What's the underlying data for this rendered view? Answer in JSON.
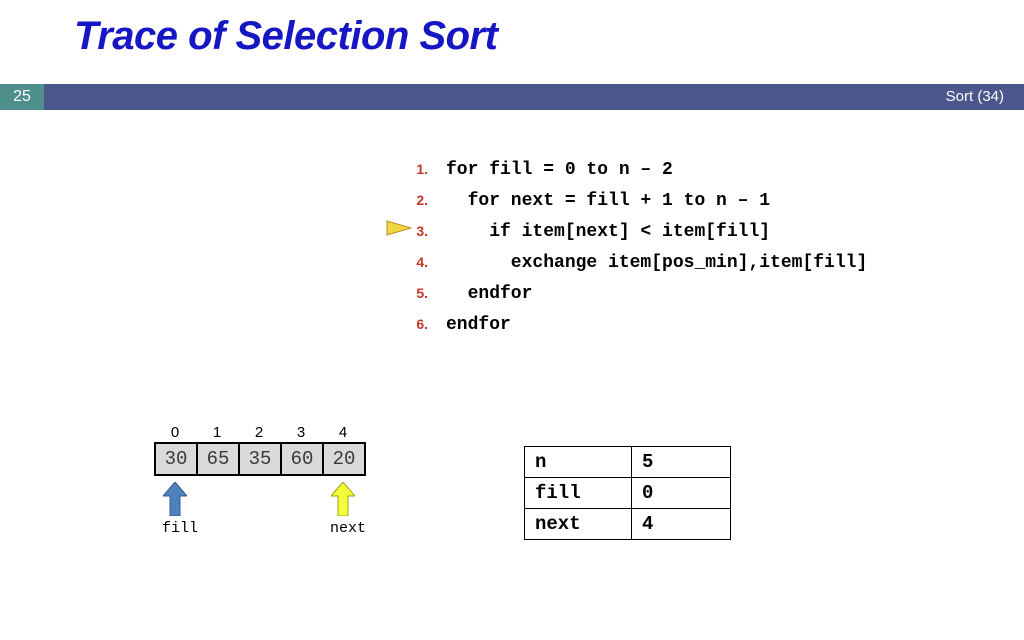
{
  "title": "Trace of Selection Sort",
  "page_number": "25",
  "banner_right": "Sort (34)",
  "code": {
    "l1": {
      "n": "1.",
      "t": "for fill = 0 to n – 2"
    },
    "l2": {
      "n": "2.",
      "t": "  for next = fill + 1 to n – 1"
    },
    "l3": {
      "n": "3.",
      "t": "    if item[next] < item[fill]"
    },
    "l4": {
      "n": "4.",
      "t": "      exchange item[pos_min],item[fill]"
    },
    "l5": {
      "n": "5.",
      "t": "  endfor"
    },
    "l6": {
      "n": "6.",
      "t": "endfor"
    }
  },
  "array": {
    "indices": [
      "0",
      "1",
      "2",
      "3",
      "4"
    ],
    "values": [
      "30",
      "65",
      "35",
      "60",
      "20"
    ]
  },
  "arrows": {
    "fill_label": "fill",
    "next_label": "next"
  },
  "vars": {
    "r1": {
      "k": "n",
      "v": "5"
    },
    "r2": {
      "k": "fill",
      "v": "0"
    },
    "r3": {
      "k": "next",
      "v": "4"
    }
  },
  "chart_data": {
    "type": "table",
    "array_indices": [
      0,
      1,
      2,
      3,
      4
    ],
    "array_values": [
      30,
      65,
      35,
      60,
      20
    ],
    "variables": {
      "n": 5,
      "fill": 0,
      "next": 4
    },
    "current_code_line": 3
  }
}
